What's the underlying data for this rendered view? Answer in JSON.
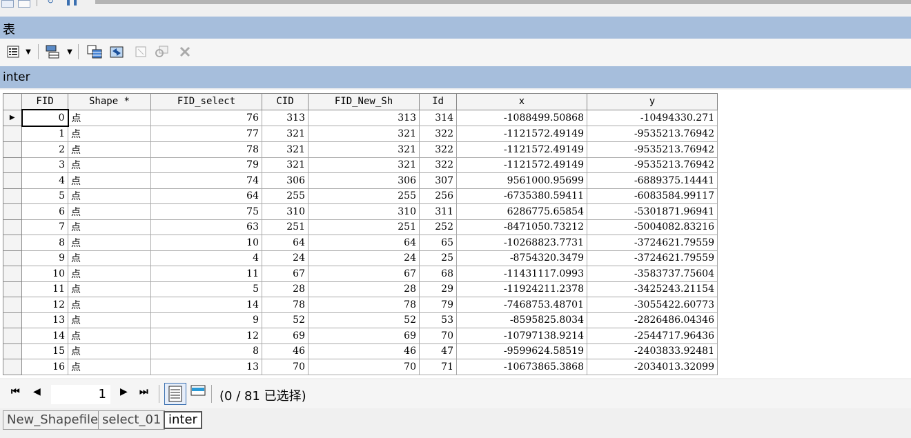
{
  "window": {
    "title": "表"
  },
  "toolbar": {
    "icons": [
      "table-options-icon",
      "dropdown-icon",
      "related-tables-icon",
      "dropdown-icon",
      "select-by-attributes-icon",
      "switch-selection-icon",
      "clear-selection-icon",
      "zoom-to-selected-icon",
      "delete-selected-icon"
    ]
  },
  "table_tab": {
    "name": "inter"
  },
  "grid": {
    "columns": [
      "FID",
      "Shape *",
      "FID_select",
      "CID",
      "FID_New_Sh",
      "Id",
      "x",
      "y"
    ],
    "rows": [
      [
        "0",
        "点",
        "76",
        "313",
        "313",
        "314",
        "-1088499.50868",
        "-10494330.271"
      ],
      [
        "1",
        "点",
        "77",
        "321",
        "321",
        "322",
        "-1121572.49149",
        "-9535213.76942"
      ],
      [
        "2",
        "点",
        "78",
        "321",
        "321",
        "322",
        "-1121572.49149",
        "-9535213.76942"
      ],
      [
        "3",
        "点",
        "79",
        "321",
        "321",
        "322",
        "-1121572.49149",
        "-9535213.76942"
      ],
      [
        "4",
        "点",
        "74",
        "306",
        "306",
        "307",
        "9561000.95699",
        "-6889375.14441"
      ],
      [
        "5",
        "点",
        "64",
        "255",
        "255",
        "256",
        "-6735380.59411",
        "-6083584.99117"
      ],
      [
        "6",
        "点",
        "75",
        "310",
        "310",
        "311",
        "6286775.65854",
        "-5301871.96941"
      ],
      [
        "7",
        "点",
        "63",
        "251",
        "251",
        "252",
        "-8471050.73212",
        "-5004082.83216"
      ],
      [
        "8",
        "点",
        "10",
        "64",
        "64",
        "65",
        "-10268823.7731",
        "-3724621.79559"
      ],
      [
        "9",
        "点",
        "4",
        "24",
        "24",
        "25",
        "-8754320.3479",
        "-3724621.79559"
      ],
      [
        "10",
        "点",
        "11",
        "67",
        "67",
        "68",
        "-11431117.0993",
        "-3583737.75604"
      ],
      [
        "11",
        "点",
        "5",
        "28",
        "28",
        "29",
        "-11924211.2378",
        "-3425243.21154"
      ],
      [
        "12",
        "点",
        "14",
        "78",
        "78",
        "79",
        "-7468753.48701",
        "-3055422.60773"
      ],
      [
        "13",
        "点",
        "9",
        "52",
        "52",
        "53",
        "-8595825.8034",
        "-2826486.04346"
      ],
      [
        "14",
        "点",
        "12",
        "69",
        "69",
        "70",
        "-10797138.9214",
        "-2544717.96436"
      ],
      [
        "15",
        "点",
        "8",
        "46",
        "46",
        "47",
        "-9599624.58519",
        "-2403833.92481"
      ],
      [
        "16",
        "点",
        "13",
        "70",
        "70",
        "71",
        "-10673865.3868",
        "-2034013.32099"
      ]
    ]
  },
  "status": {
    "current_record": "1",
    "selection_text": "(0 / 81 已选择)"
  },
  "tabs": [
    "New_Shapefile",
    "select_01",
    "inter"
  ]
}
